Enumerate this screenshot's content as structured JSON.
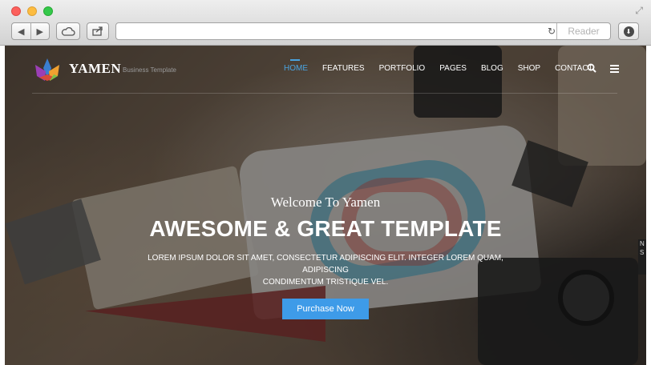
{
  "browser": {
    "reader_label": "Reader",
    "address_value": "",
    "resize_glyph": "⤢",
    "back_glyph": "◀",
    "forward_glyph": "▶",
    "reload_glyph": "↻",
    "download_glyph": "⬇"
  },
  "site": {
    "brand": "YAMEN",
    "tagline": "Business Template",
    "nav": [
      {
        "label": "HOME",
        "active": true
      },
      {
        "label": "FEATURES"
      },
      {
        "label": "PORTFOLIO"
      },
      {
        "label": "PAGES"
      },
      {
        "label": "BLOG"
      },
      {
        "label": "SHOP"
      },
      {
        "label": "CONTACT"
      }
    ],
    "accent_color": "#4aa3df",
    "button_color": "#3e9be8"
  },
  "hero": {
    "welcome": "Welcome To Yamen",
    "headline": "AWESOME & GREAT TEMPLATE",
    "subtext_line1": "LOREM IPSUM DOLOR SIT AMET, CONSECTETUR ADIPISCING ELIT. INTEGER LOREM QUAM, ADIPISCING",
    "subtext_line2": "CONDIMENTUM TRISTIQUE VEL.",
    "cta": "Purchase Now"
  },
  "side_tab": {
    "line1": "N",
    "line2": "S"
  }
}
